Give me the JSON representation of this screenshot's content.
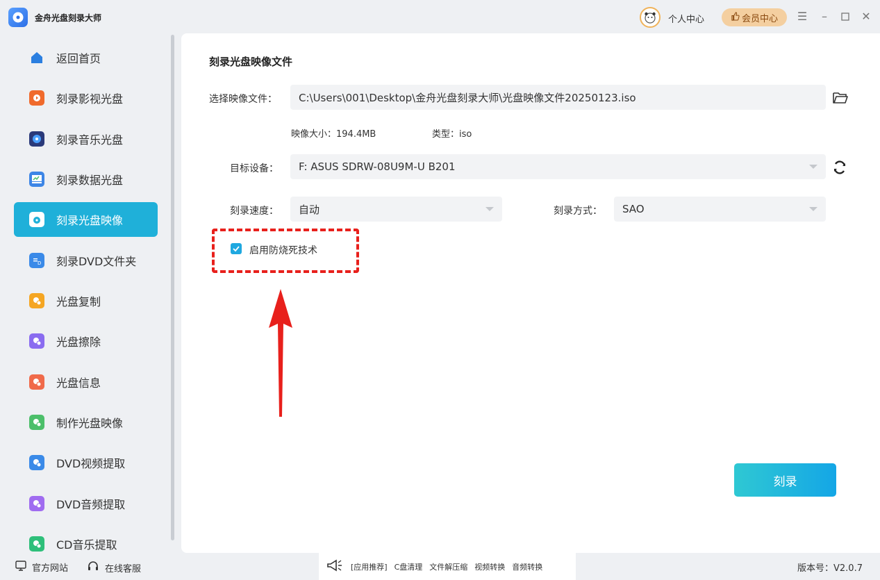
{
  "app": {
    "title": "金舟光盘刻录大师"
  },
  "header": {
    "personal_center": "个人中心",
    "vip_center": "会员中心"
  },
  "sidebar": {
    "items": [
      {
        "label": "返回首页",
        "icon": "home-icon",
        "color": "#2b7fe0"
      },
      {
        "label": "刻录影视光盘",
        "icon": "video-disc-icon",
        "color": "#f06a2c"
      },
      {
        "label": "刻录音乐光盘",
        "icon": "music-disc-icon",
        "color": "#2a3a7a"
      },
      {
        "label": "刻录数据光盘",
        "icon": "data-disc-icon",
        "color": "#3d86e6"
      },
      {
        "label": "刻录光盘映像",
        "icon": "disc-image-icon",
        "color": "#ffffff"
      },
      {
        "label": "刻录DVD文件夹",
        "icon": "dvd-folder-icon",
        "color": "#3a8ae8"
      },
      {
        "label": "光盘复制",
        "icon": "disc-copy-icon",
        "color": "#f5a623"
      },
      {
        "label": "光盘擦除",
        "icon": "disc-erase-icon",
        "color": "#8a6cf0"
      },
      {
        "label": "光盘信息",
        "icon": "disc-info-icon",
        "color": "#f06a4a"
      },
      {
        "label": "制作光盘映像",
        "icon": "make-image-icon",
        "color": "#4cbf6a"
      },
      {
        "label": "DVD视频提取",
        "icon": "dvd-video-extract-icon",
        "color": "#3a8ae8"
      },
      {
        "label": "DVD音频提取",
        "icon": "dvd-audio-extract-icon",
        "color": "#a06cf0"
      },
      {
        "label": "CD音乐提取",
        "icon": "cd-music-extract-icon",
        "color": "#2ebf7a"
      }
    ],
    "active_index": 4
  },
  "main": {
    "heading": "刻录光盘映像文件",
    "image_file_label": "选择映像文件：",
    "image_file_value": "C:\\Users\\001\\Desktop\\金舟光盘刻录大师\\光盘映像文件20250123.iso",
    "size_text": "映像大小：194.4MB",
    "type_text": "类型：iso",
    "device_label": "目标设备：",
    "device_value": "F: ASUS SDRW-08U9M-U B201",
    "speed_label": "刻录速度：",
    "speed_value": "自动",
    "mode_label": "刻录方式：",
    "mode_value": "SAO",
    "antiburn_label": "启用防烧死技术",
    "antiburn_checked": true,
    "burn_button": "刻录"
  },
  "footer": {
    "website": "官方网站",
    "support": "在线客服",
    "promo_items": [
      "[应用推荐]",
      "C盘清理",
      "文件解压缩",
      "视频转换",
      "音频转换"
    ],
    "version": "版本号：V2.0.7"
  },
  "colors": {
    "accent": "#1fb0d9",
    "annotation": "#e8201c",
    "vip": "#f4cfa0"
  }
}
